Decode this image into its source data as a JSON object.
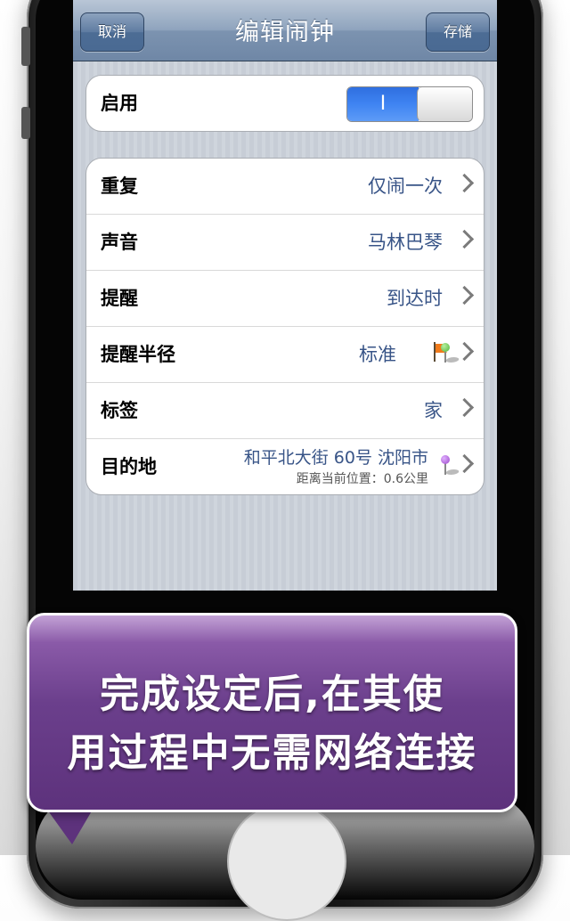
{
  "navbar": {
    "title": "编辑闹钟",
    "cancel_label": "取消",
    "save_label": "存储"
  },
  "enable": {
    "label": "启用",
    "toggle_on_text": "I",
    "state": "on"
  },
  "settings": {
    "repeat": {
      "label": "重复",
      "value": "仅闹一次"
    },
    "sound": {
      "label": "声音",
      "value": "马林巴琴"
    },
    "remind": {
      "label": "提醒",
      "value": "到达时"
    },
    "radius": {
      "label": "提醒半径",
      "value": "标准"
    },
    "tag": {
      "label": "标签",
      "value": "家"
    },
    "destination": {
      "label": "目的地",
      "value": "和平北大街 60号 沈阳市",
      "distance": "距离当前位置：0.6公里"
    }
  },
  "icons": {
    "flag": "orange-flag-icon",
    "green_pin": "green-pin-icon",
    "purple_pin": "purple-pin-icon"
  },
  "colors": {
    "value_text": "#385487",
    "toggle_on": "#3f84f2",
    "callout_bg": "#6b3f8c",
    "flag": "#f07a1a",
    "green_pin": "#4fb43a",
    "purple_pin": "#9b46c9"
  },
  "callout": {
    "line1": "完成设定后,在其使",
    "line2": "用过程中无需网络连接"
  }
}
